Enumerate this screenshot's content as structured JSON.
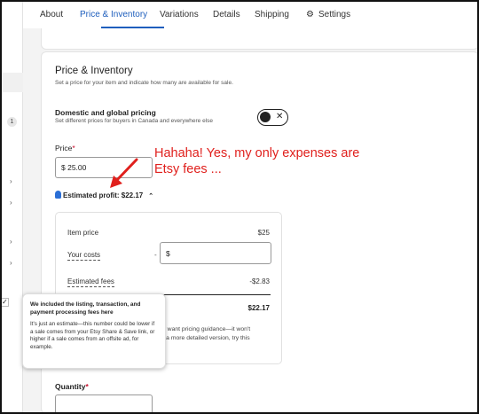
{
  "tabs": [
    {
      "label": "About"
    },
    {
      "label": "Price & Inventory"
    },
    {
      "label": "Variations"
    },
    {
      "label": "Details"
    },
    {
      "label": "Shipping"
    },
    {
      "label": "Settings"
    }
  ],
  "sidebar": {
    "badge": "1"
  },
  "section": {
    "title": "Price & Inventory",
    "subtitle": "Set a price for your item and indicate how many are available for sale."
  },
  "pricing_toggle": {
    "title": "Domestic and global pricing",
    "subtitle": "Set different prices for buyers in Canada and everywhere else",
    "off_glyph": "✕"
  },
  "price": {
    "label": "Price",
    "required_mark": "*",
    "value": "$  25.00"
  },
  "annotation": {
    "line1": "Hahaha! Yes, my only expenses are",
    "line2": "Etsy fees ..."
  },
  "profit": {
    "label": "Estimated profit: $22.17",
    "caret": "⌃"
  },
  "breakdown": {
    "item_price_label": "Item price",
    "item_price_value": "$25",
    "costs_label": "Your costs",
    "costs_dash": "-",
    "costs_placeholder": "$",
    "fees_label": "Estimated fees",
    "fees_value": "-$2.83",
    "total_value": "$22.17",
    "guidance_line1": "o want pricing guidance—it won't",
    "guidance_line2": "r a more detailed version, try this"
  },
  "tooltip": {
    "title": "We included the listing, transaction, and payment processing fees here",
    "body": "It's just an estimate—this number could be lower if a sale comes from your Etsy Share & Save link, or higher if a sale comes from an offsite ad, for example."
  },
  "quantity": {
    "label": "Quantity",
    "required_mark": "*"
  },
  "colors": {
    "accent": "#1f5fbd",
    "annotation": "#e0201d",
    "required": "#c8102e"
  }
}
